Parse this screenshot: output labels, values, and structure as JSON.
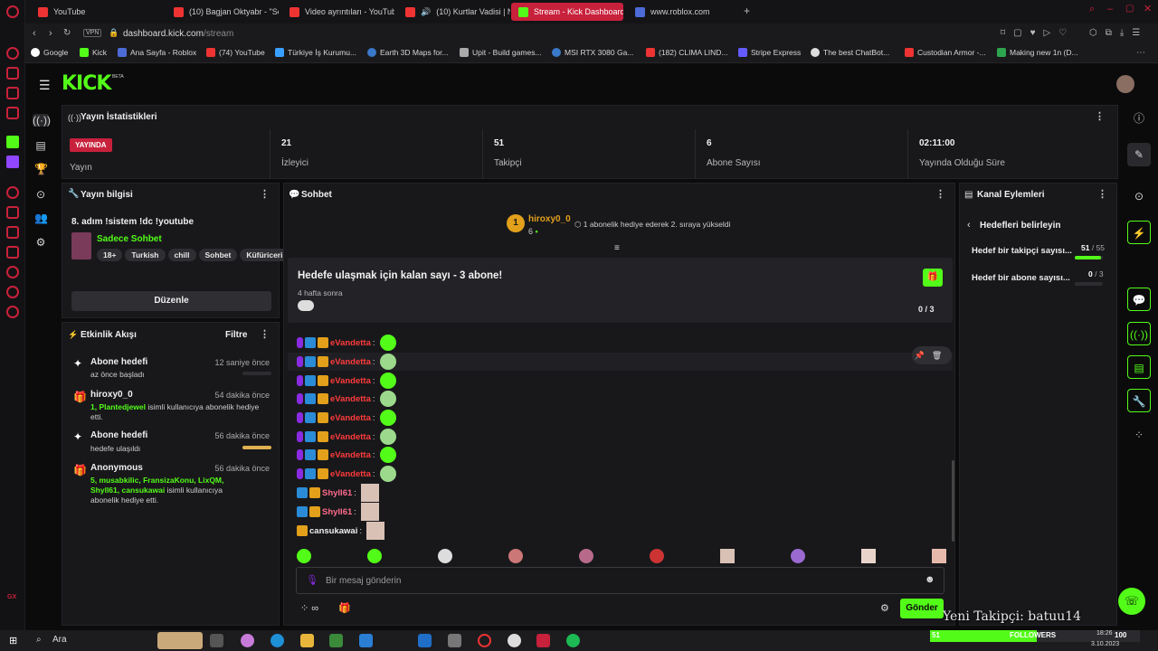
{
  "browser": {
    "tabs": [
      {
        "title": "YouTube",
        "active": false
      },
      {
        "title": "(10) Bagjan Oktyabr - \"So",
        "active": false
      },
      {
        "title": "Video ayrıntıları - YouTub",
        "active": false
      },
      {
        "title": "(10) Kurtlar Vadisi | Ni",
        "active": false
      },
      {
        "title": "Stream - Kick Dashboard",
        "active": true
      },
      {
        "title": "www.roblox.com",
        "active": false
      }
    ],
    "vpn_label": "VPN",
    "url_host": "dashboard.kick.com",
    "url_path": "/stream",
    "bookmarks": [
      "Google",
      "Kick",
      "Ana Sayfa - Roblox",
      "(74) YouTube",
      "Türkiye İş Kurumu...",
      "Earth 3D Maps for...",
      "Upit - Build games...",
      "MSI RTX 3080 Ga...",
      "(182) CLIMA LIND...",
      "Stripe Express",
      "The best ChatBot...",
      "Custodian Armor -...",
      "Making new 1n (D..."
    ]
  },
  "header": {
    "logo": "KICK",
    "beta": "BETA"
  },
  "stats": {
    "title": "Yayın İstatistikleri",
    "live_badge": "YAYINDA",
    "live_label": "Yayın",
    "viewers_value": "21",
    "viewers_label": "İzleyici",
    "followers_value": "51",
    "followers_label": "Takipçi",
    "subs_value": "6",
    "subs_label": "Abone Sayısı",
    "duration_value": "02:11:00",
    "duration_label": "Yayında Olduğu Süre"
  },
  "stream_info": {
    "title": "Yayın bilgisi",
    "stream_title": "8. adım !sistem !dc !youtube",
    "category": "Sadece Sohbet",
    "tags": [
      "18+",
      "Turkish",
      "chill",
      "Sohbet",
      "Küfüriceri"
    ],
    "edit_button": "Düzenle"
  },
  "activity": {
    "title": "Etkinlik Akışı",
    "filter": "Filtre",
    "items": [
      {
        "title": "Abone hedefi",
        "sub": "az önce başladı",
        "time": "12 saniye önce"
      },
      {
        "title": "hiroxy0_0",
        "highlight": "1, Plantedjewel",
        "sub": "isimli kullanıcıya abonelik hediye etti.",
        "time": "54 dakika önce"
      },
      {
        "title": "Abone hedefi",
        "sub": "hedefe ulaşıldı",
        "time": "56 dakika önce"
      },
      {
        "title": "Anonymous",
        "highlight": "5, musabkilic, FransizaKonu, LixQM, Shyll61, cansukawai",
        "sub": "isimli kullanıcıya abonelik hediye etti.",
        "time": "56 dakika önce"
      }
    ]
  },
  "chat": {
    "title": "Sohbet",
    "pinned_user": "hiroxy0_0",
    "pinned_rank": "1",
    "pinned_count": "6",
    "pinned_text": "1 abonelik hediye ederek 2. sıraya yükseldi",
    "goal_title": "Hedefe ulaşmak için kalan sayı - 3 abone!",
    "goal_time": "4 hafta sonra",
    "goal_progress": "0 / 3",
    "messages": [
      {
        "user": "eVandetta",
        "sep": ":"
      },
      {
        "user": "eVandetta",
        "sep": ":"
      },
      {
        "user": "eVandetta",
        "sep": ":"
      },
      {
        "user": "eVandetta",
        "sep": ":"
      },
      {
        "user": "eVandetta",
        "sep": ":"
      },
      {
        "user": "eVandetta",
        "sep": ":"
      },
      {
        "user": "eVandetta",
        "sep": ":"
      },
      {
        "user": "eVandetta",
        "sep": ":"
      },
      {
        "user": "Shyll61",
        "sep": ":"
      },
      {
        "user": "Shyll61",
        "sep": ":"
      },
      {
        "user": "cansukawai",
        "sep": ":"
      }
    ],
    "input_placeholder": "Bir mesaj gönderin",
    "send_button": "Gönder"
  },
  "channel_actions": {
    "title": "Kanal Eylemleri",
    "back_label": "Hedefleri belirleyin",
    "goals": [
      {
        "label": "Hedef bir takipçi sayısı...",
        "current": "51",
        "target": "55",
        "fill": 0.93
      },
      {
        "label": "Hedef bir abone sayısı...",
        "current": "0",
        "target": "3",
        "fill": 0.0
      }
    ]
  },
  "overlay": {
    "new_follower": "Yeni Takipçi: batuu14",
    "followers_count": "51",
    "followers_label": "FOLLOWERS",
    "followers_goal": "100"
  },
  "taskbar": {
    "search": "Ara",
    "time": "18:26",
    "date": "3.10.2023"
  },
  "colors": {
    "kick_green": "#53fc18",
    "live_red": "#c8213c",
    "panel_bg": "#18181b"
  }
}
